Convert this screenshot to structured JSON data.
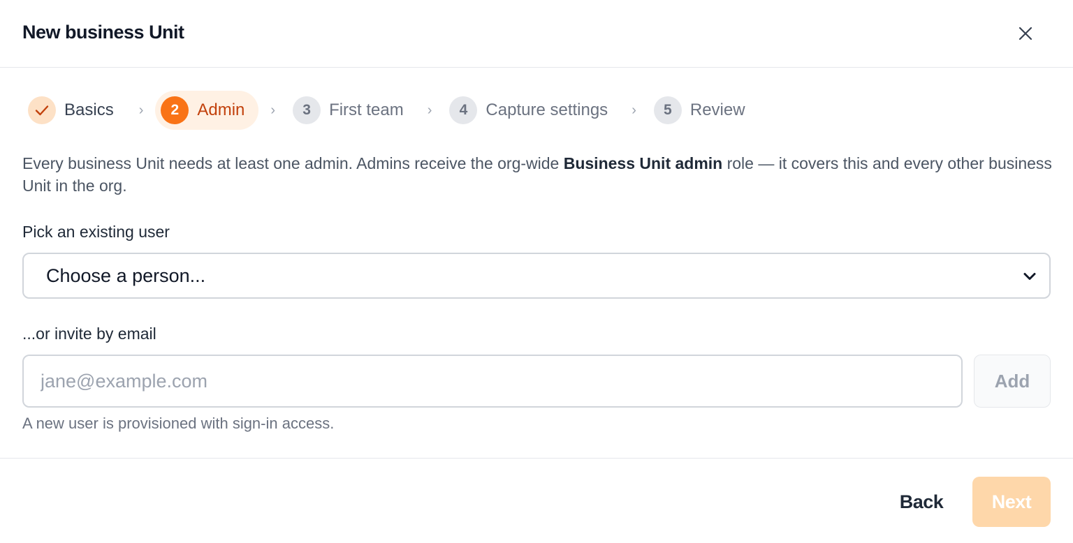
{
  "dialog": {
    "title": "New business Unit"
  },
  "stepper": {
    "steps": [
      {
        "badge": "",
        "label": "Basics",
        "state": "done",
        "icon": "check-icon"
      },
      {
        "badge": "2",
        "label": "Admin",
        "state": "active"
      },
      {
        "badge": "3",
        "label": "First team",
        "state": "upcoming"
      },
      {
        "badge": "4",
        "label": "Capture settings",
        "state": "upcoming"
      },
      {
        "badge": "5",
        "label": "Review",
        "state": "upcoming"
      }
    ],
    "separator": "›"
  },
  "description": {
    "before": "Every business Unit needs at least one admin. Admins receive the org-wide ",
    "bold": "Business Unit admin",
    "after": " role — it covers this and every other business Unit in the org."
  },
  "pick_user": {
    "label": "Pick an existing user",
    "selected": "Choose a person..."
  },
  "invite": {
    "label": "...or invite by email",
    "placeholder": "jane@example.com",
    "value": "",
    "add_label": "Add",
    "hint": "A new user is provisioned with sign-in access."
  },
  "footer": {
    "back_label": "Back",
    "next_label": "Next"
  },
  "colors": {
    "accent": "#f97316",
    "accent_light": "#fff1e4",
    "next_disabled": "#fed7aa"
  }
}
